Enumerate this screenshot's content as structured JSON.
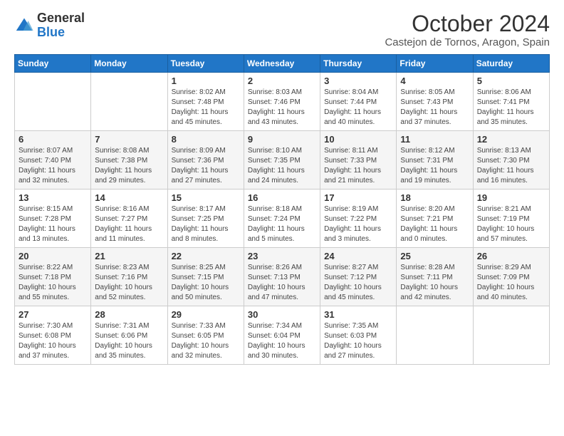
{
  "logo": {
    "general": "General",
    "blue": "Blue"
  },
  "header": {
    "month": "October 2024",
    "location": "Castejon de Tornos, Aragon, Spain"
  },
  "weekdays": [
    "Sunday",
    "Monday",
    "Tuesday",
    "Wednesday",
    "Thursday",
    "Friday",
    "Saturday"
  ],
  "weeks": [
    [
      {
        "day": "",
        "info": ""
      },
      {
        "day": "",
        "info": ""
      },
      {
        "day": "1",
        "info": "Sunrise: 8:02 AM\nSunset: 7:48 PM\nDaylight: 11 hours and 45 minutes."
      },
      {
        "day": "2",
        "info": "Sunrise: 8:03 AM\nSunset: 7:46 PM\nDaylight: 11 hours and 43 minutes."
      },
      {
        "day": "3",
        "info": "Sunrise: 8:04 AM\nSunset: 7:44 PM\nDaylight: 11 hours and 40 minutes."
      },
      {
        "day": "4",
        "info": "Sunrise: 8:05 AM\nSunset: 7:43 PM\nDaylight: 11 hours and 37 minutes."
      },
      {
        "day": "5",
        "info": "Sunrise: 8:06 AM\nSunset: 7:41 PM\nDaylight: 11 hours and 35 minutes."
      }
    ],
    [
      {
        "day": "6",
        "info": "Sunrise: 8:07 AM\nSunset: 7:40 PM\nDaylight: 11 hours and 32 minutes."
      },
      {
        "day": "7",
        "info": "Sunrise: 8:08 AM\nSunset: 7:38 PM\nDaylight: 11 hours and 29 minutes."
      },
      {
        "day": "8",
        "info": "Sunrise: 8:09 AM\nSunset: 7:36 PM\nDaylight: 11 hours and 27 minutes."
      },
      {
        "day": "9",
        "info": "Sunrise: 8:10 AM\nSunset: 7:35 PM\nDaylight: 11 hours and 24 minutes."
      },
      {
        "day": "10",
        "info": "Sunrise: 8:11 AM\nSunset: 7:33 PM\nDaylight: 11 hours and 21 minutes."
      },
      {
        "day": "11",
        "info": "Sunrise: 8:12 AM\nSunset: 7:31 PM\nDaylight: 11 hours and 19 minutes."
      },
      {
        "day": "12",
        "info": "Sunrise: 8:13 AM\nSunset: 7:30 PM\nDaylight: 11 hours and 16 minutes."
      }
    ],
    [
      {
        "day": "13",
        "info": "Sunrise: 8:15 AM\nSunset: 7:28 PM\nDaylight: 11 hours and 13 minutes."
      },
      {
        "day": "14",
        "info": "Sunrise: 8:16 AM\nSunset: 7:27 PM\nDaylight: 11 hours and 11 minutes."
      },
      {
        "day": "15",
        "info": "Sunrise: 8:17 AM\nSunset: 7:25 PM\nDaylight: 11 hours and 8 minutes."
      },
      {
        "day": "16",
        "info": "Sunrise: 8:18 AM\nSunset: 7:24 PM\nDaylight: 11 hours and 5 minutes."
      },
      {
        "day": "17",
        "info": "Sunrise: 8:19 AM\nSunset: 7:22 PM\nDaylight: 11 hours and 3 minutes."
      },
      {
        "day": "18",
        "info": "Sunrise: 8:20 AM\nSunset: 7:21 PM\nDaylight: 11 hours and 0 minutes."
      },
      {
        "day": "19",
        "info": "Sunrise: 8:21 AM\nSunset: 7:19 PM\nDaylight: 10 hours and 57 minutes."
      }
    ],
    [
      {
        "day": "20",
        "info": "Sunrise: 8:22 AM\nSunset: 7:18 PM\nDaylight: 10 hours and 55 minutes."
      },
      {
        "day": "21",
        "info": "Sunrise: 8:23 AM\nSunset: 7:16 PM\nDaylight: 10 hours and 52 minutes."
      },
      {
        "day": "22",
        "info": "Sunrise: 8:25 AM\nSunset: 7:15 PM\nDaylight: 10 hours and 50 minutes."
      },
      {
        "day": "23",
        "info": "Sunrise: 8:26 AM\nSunset: 7:13 PM\nDaylight: 10 hours and 47 minutes."
      },
      {
        "day": "24",
        "info": "Sunrise: 8:27 AM\nSunset: 7:12 PM\nDaylight: 10 hours and 45 minutes."
      },
      {
        "day": "25",
        "info": "Sunrise: 8:28 AM\nSunset: 7:11 PM\nDaylight: 10 hours and 42 minutes."
      },
      {
        "day": "26",
        "info": "Sunrise: 8:29 AM\nSunset: 7:09 PM\nDaylight: 10 hours and 40 minutes."
      }
    ],
    [
      {
        "day": "27",
        "info": "Sunrise: 7:30 AM\nSunset: 6:08 PM\nDaylight: 10 hours and 37 minutes."
      },
      {
        "day": "28",
        "info": "Sunrise: 7:31 AM\nSunset: 6:06 PM\nDaylight: 10 hours and 35 minutes."
      },
      {
        "day": "29",
        "info": "Sunrise: 7:33 AM\nSunset: 6:05 PM\nDaylight: 10 hours and 32 minutes."
      },
      {
        "day": "30",
        "info": "Sunrise: 7:34 AM\nSunset: 6:04 PM\nDaylight: 10 hours and 30 minutes."
      },
      {
        "day": "31",
        "info": "Sunrise: 7:35 AM\nSunset: 6:03 PM\nDaylight: 10 hours and 27 minutes."
      },
      {
        "day": "",
        "info": ""
      },
      {
        "day": "",
        "info": ""
      }
    ]
  ]
}
